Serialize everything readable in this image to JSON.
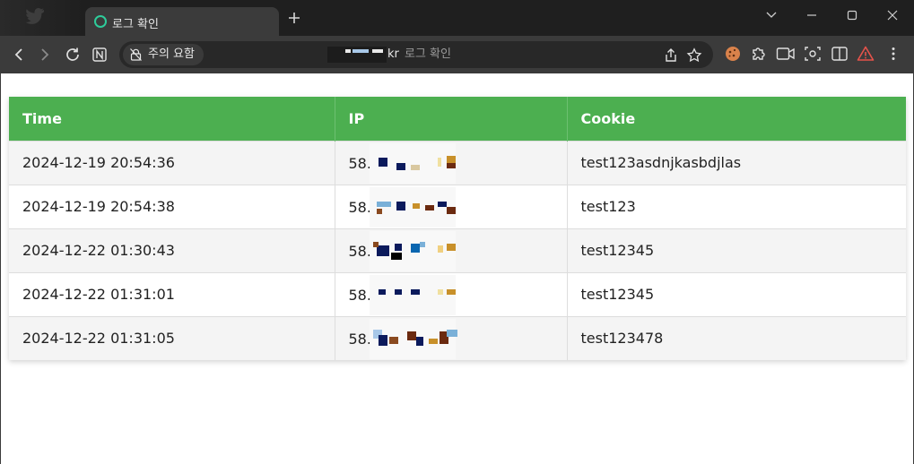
{
  "browser": {
    "tab_title": "로그 확인",
    "new_tab_icon": "plus-icon",
    "address": {
      "security_chip": "주의 요함",
      "domain_tail": "kr",
      "page_title": "로그 확인"
    },
    "accent_colors": {
      "warning": "#e5534b",
      "tab_favicon": "#2ecc9a"
    }
  },
  "table": {
    "header_color": "#4caf50",
    "columns": [
      "Time",
      "IP",
      "Cookie"
    ],
    "rows": [
      {
        "time": "2024-12-19 20:54:36",
        "ip_visible": "58.",
        "cookie": "test123asdnjkasbdjlas"
      },
      {
        "time": "2024-12-19 20:54:38",
        "ip_visible": "58.",
        "cookie": "test123"
      },
      {
        "time": "2024-12-22 01:30:43",
        "ip_visible": "58.",
        "cookie": "test12345"
      },
      {
        "time": "2024-12-22 01:31:01",
        "ip_visible": "58.",
        "cookie": "test12345"
      },
      {
        "time": "2024-12-22 01:31:05",
        "ip_visible": "58.",
        "cookie": "test123478"
      }
    ]
  }
}
